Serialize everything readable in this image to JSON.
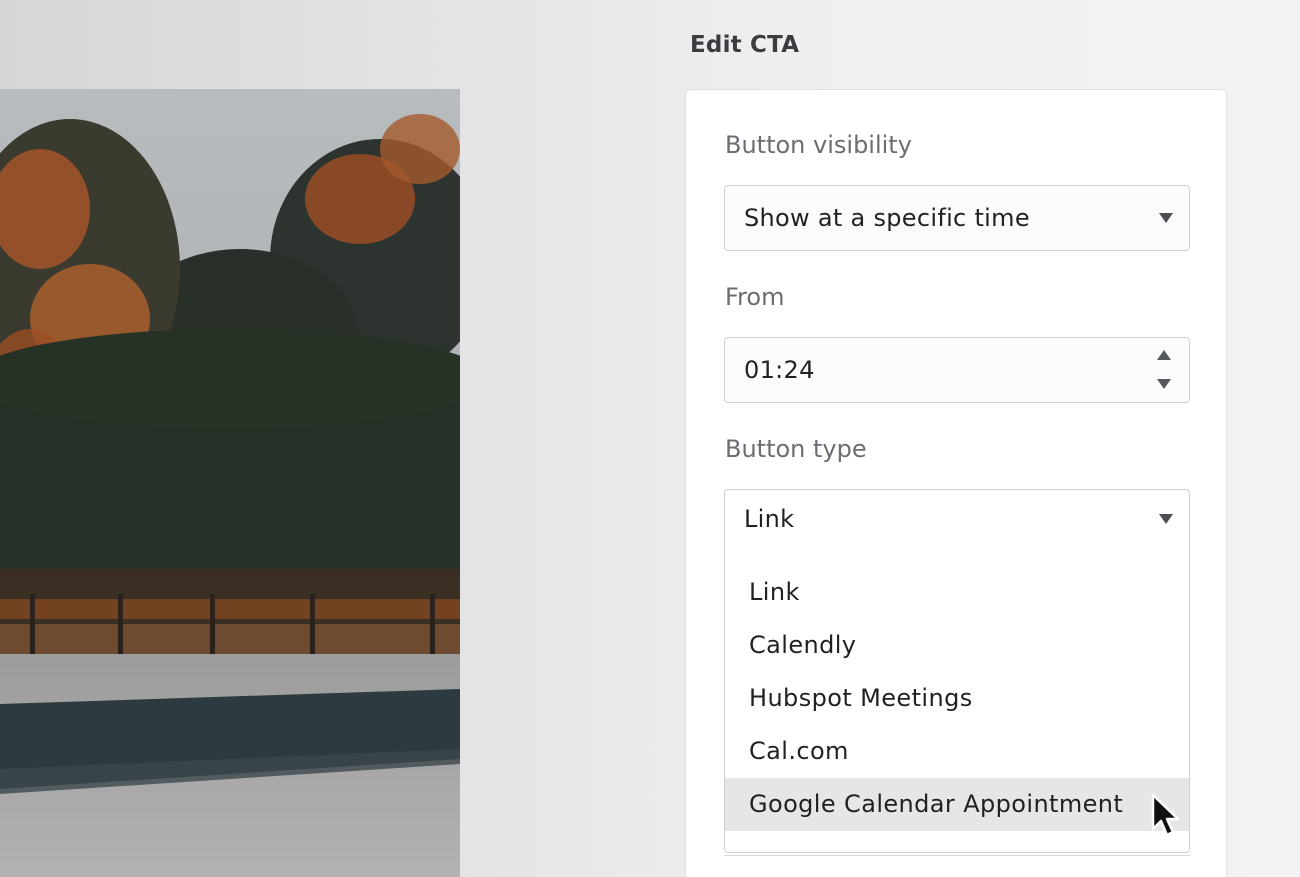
{
  "panel": {
    "title": "Edit CTA"
  },
  "fields": {
    "visibility": {
      "label": "Button visibility",
      "value": "Show at a specific time"
    },
    "from": {
      "label": "From",
      "value": "01:24"
    },
    "button_type": {
      "label": "Button type",
      "value": "Link",
      "options": [
        "Link",
        "Calendly",
        "Hubspot Meetings",
        "Cal.com",
        "Google Calendar Appointment"
      ],
      "hovered_option": "Google Calendar Appointment"
    }
  },
  "icons": {
    "visibility_caret": "caret-down-icon",
    "from_spinner": "spinner-arrows-icon",
    "type_caret": "caret-down-icon",
    "cursor": "mouse-pointer-icon"
  },
  "colors": {
    "background": "#f3f3f5",
    "card": "#ffffff",
    "label": "#6a6d72",
    "text": "#1f2125",
    "hover": "#e6e6e7"
  }
}
